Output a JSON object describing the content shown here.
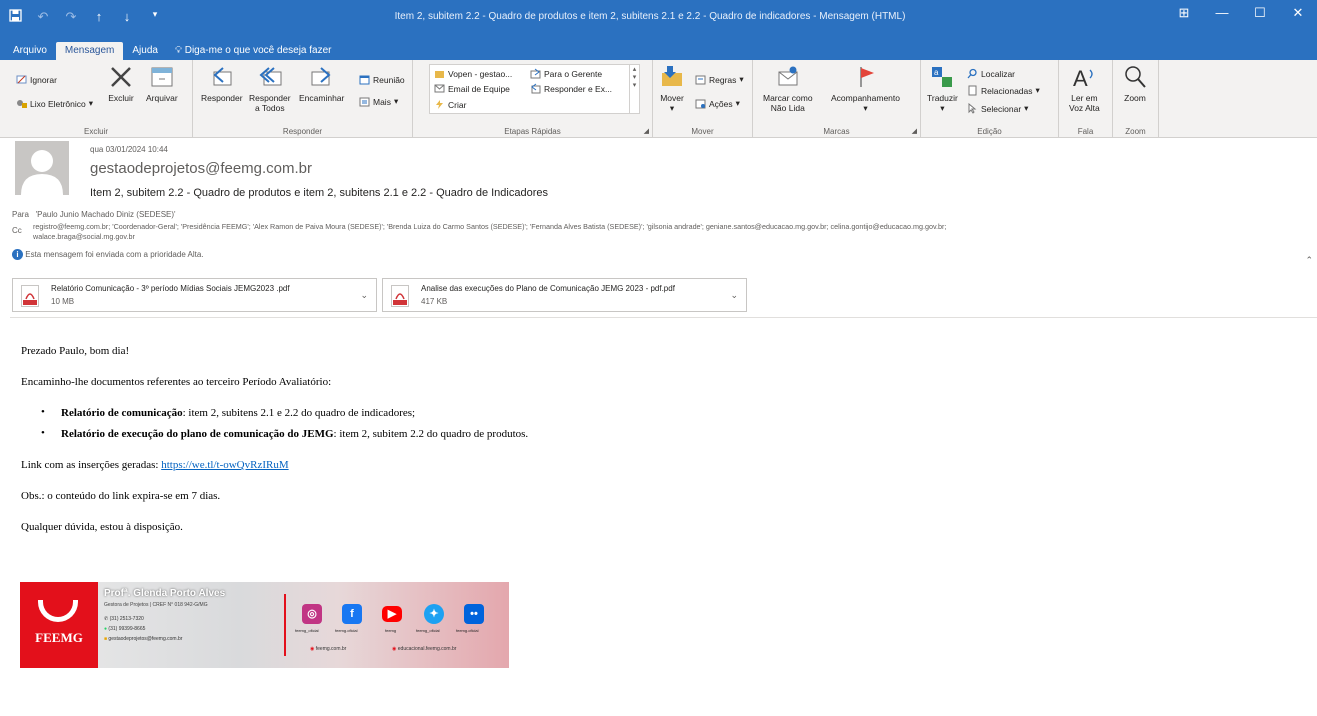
{
  "window": {
    "title": "Item 2, subitem 2.2 - Quadro de produtos e item 2, subitens  2.1 e 2.2 - Quadro de indicadores  -  Mensagem (HTML)",
    "qat_icons": [
      "save-icon",
      "undo-icon",
      "redo-icon",
      "up-arrow-icon",
      "down-arrow-icon",
      "customize-icon"
    ],
    "controls": {
      "restore": "⊞",
      "minimize": "—",
      "maximize": "☐",
      "close": "✕"
    }
  },
  "tabs": [
    {
      "label": "Arquivo"
    },
    {
      "label": "Mensagem",
      "active": true
    },
    {
      "label": "Ajuda"
    }
  ],
  "tellme": "Diga-me o que você deseja fazer",
  "ribbon": {
    "excluir": {
      "label": "Excluir",
      "ignorar": "Ignorar",
      "lixo": "Lixo Eletrônico",
      "excluir": "Excluir",
      "arquivar": "Arquivar"
    },
    "responder": {
      "label": "Responder",
      "responder": "Responder",
      "responder_todos_1": "Responder",
      "responder_todos_2": "a Todos",
      "encaminhar": "Encaminhar",
      "reuniao": "Reunião",
      "mais": "Mais"
    },
    "etapas": {
      "label": "Etapas Rápidas",
      "item1": "Vopen - gestao...",
      "item2": "Para o Gerente",
      "item3": "Email de Equipe",
      "item4": "Responder e Ex...",
      "item5": "Criar"
    },
    "mover": {
      "label": "Mover",
      "mover": "Mover",
      "regras": "Regras",
      "acoes": "Ações"
    },
    "marcas": {
      "label": "Marcas",
      "marcar_1": "Marcar como",
      "marcar_2": "Não Lida",
      "acompanhamento": "Acompanhamento"
    },
    "edicao": {
      "label": "Edição",
      "traduzir": "Traduzir",
      "localizar": "Localizar",
      "relacionadas": "Relacionadas",
      "selecionar": "Selecionar"
    },
    "fala": {
      "label": "Fala",
      "ler_1": "Ler em",
      "ler_2": "Voz Alta"
    },
    "zoom": {
      "label": "Zoom",
      "zoom": "Zoom"
    }
  },
  "message": {
    "date": "qua 03/01/2024 10:44",
    "sender": "gestaodeprojetos@feemg.com.br",
    "subject": "Item 2, subitem 2.2 - Quadro de produtos e item 2, subitens  2.1 e 2.2 - Quadro de Indicadores",
    "to_label": "Para",
    "to": "'Paulo Junio Machado Diniz (SEDESE)'",
    "cc_label": "Cc",
    "cc_line1": "registro@feemg.com.br; 'Coordenador-Geral'; 'Presidência  FEEMG'; 'Alex Ramon de Paiva Moura (SEDESE)'; 'Brenda Luiza do Carmo Santos (SEDESE)'; 'Fernanda Alves Batista (SEDESE)'; 'gilsonia andrade'; geniane.santos@educacao.mg.gov.br; celina.gontijo@educacao.mg.gov.br;",
    "cc_line2": "walace.braga@social.mg.gov.br",
    "priority": "Esta mensagem foi enviada com a prioridade Alta."
  },
  "attachments": [
    {
      "name": "Relatório Comunicação - 3º período Mídias Sociais JEMG2023 .pdf",
      "size": "10 MB"
    },
    {
      "name": "Analise das execuções do Plano de Comunicação JEMG 2023 - pdf.pdf",
      "size": "417 KB"
    }
  ],
  "body": {
    "greeting": "Prezado Paulo, bom dia!",
    "intro": "Encaminho-lhe documentos referentes ao terceiro Período Avaliatório:",
    "bullet1_bold": "Relatório de comunicação",
    "bullet1_rest": ": item 2, subitens  2.1 e 2.2 do quadro de indicadores;",
    "bullet2_bold": "Relatório de execução do plano de comunicação do JEMG",
    "bullet2_rest": ": item 2, subitem 2.2 do quadro de produtos.",
    "link_prefix": "Link com as inserções geradas: ",
    "link": "https://we.tl/t-owQvRzIRuM",
    "obs": "Obs.: o conteúdo do link expira-se em 7 dias.",
    "closing": "Qualquer dúvida, estou à disposição."
  },
  "signature": {
    "logo_text": "FEEMG",
    "name": "Profª. Glenda Porto Alves",
    "role": "Gestora de Projetos | CREF N° 018 942-G/MG",
    "phone1": "(31) 2513-7320",
    "phone2": "(31) 99399-8665",
    "email": "gestaodeprojetos@feemg.com.br",
    "social": [
      {
        "label": "feemg_oficial",
        "color": "#c13584",
        "icon": "instagram-icon"
      },
      {
        "label": "feemg.oficial",
        "color": "#1877f2",
        "icon": "facebook-icon"
      },
      {
        "label": "feemg",
        "color": "#ff0000",
        "icon": "youtube-icon"
      },
      {
        "label": "feemg_oficial",
        "color": "#1da1f2",
        "icon": "twitter-icon"
      },
      {
        "label": "feemg.oficial",
        "color": "#0063dc",
        "icon": "flickr-icon"
      }
    ],
    "web1": "feemg.com.br",
    "web2": "educacional.feemg.com.br"
  }
}
